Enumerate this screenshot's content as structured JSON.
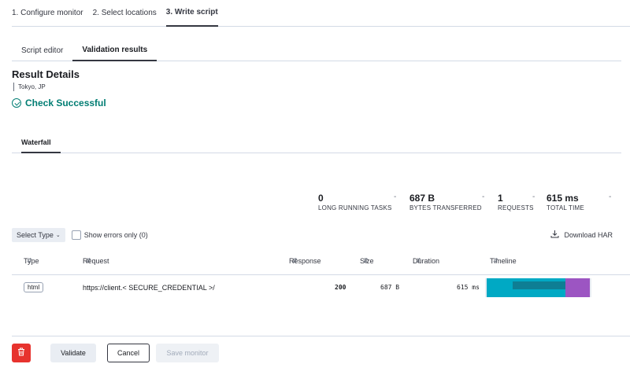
{
  "steps": [
    "1. Configure monitor",
    "2. Select locations",
    "3. Write script"
  ],
  "subtabs": [
    "Script editor",
    "Validation results"
  ],
  "result": {
    "title": "Result Details",
    "location": "Tokyo, JP",
    "status": "Check Successful"
  },
  "waterfall_tab": "Waterfall",
  "stats": [
    {
      "value": "0",
      "dash": "-",
      "label": "LONG RUNNING TASKS"
    },
    {
      "value": "687 B",
      "dash": "-",
      "label": "BYTES TRANSFERRED"
    },
    {
      "value": "1",
      "dash": "-",
      "label": "REQUESTS"
    },
    {
      "value": "615 ms",
      "dash": "-",
      "label": "TOTAL TIME"
    }
  ],
  "filters": {
    "select_type": "Select Type",
    "show_errors": "Show errors only (0)",
    "download": "Download HAR"
  },
  "table": {
    "headers": [
      "Type",
      "Request",
      "Response",
      "Size",
      "Duration",
      "Timeline"
    ],
    "rows": [
      {
        "type": "html",
        "request": "https://client.< SECURE_CREDENTIAL >/",
        "response": "200",
        "size": "687 B",
        "duration": "615 ms"
      }
    ]
  },
  "timeline_colors": {
    "wait": "#00a9c4",
    "receive": "#0e7e94",
    "end": "#9c55c2"
  },
  "actions": {
    "delete_icon": "trash-icon",
    "validate": "Validate",
    "cancel": "Cancel",
    "save": "Save monitor"
  }
}
